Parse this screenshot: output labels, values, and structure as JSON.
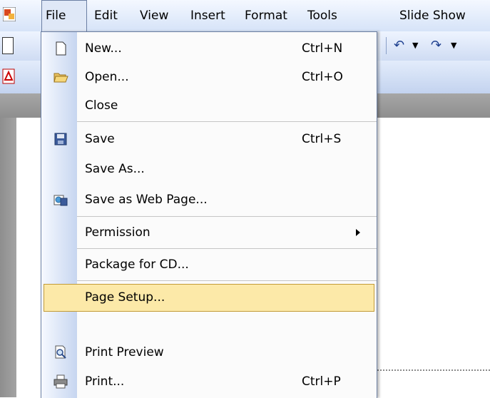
{
  "menubar": {
    "items": [
      {
        "label": "File"
      },
      {
        "label": "Edit"
      },
      {
        "label": "View"
      },
      {
        "label": "Insert"
      },
      {
        "label": "Format"
      },
      {
        "label": "Tools"
      },
      {
        "label": "Slide Show"
      }
    ]
  },
  "file_menu": {
    "items": [
      {
        "label": "New...",
        "shortcut": "Ctrl+N",
        "icon": "new-document-icon"
      },
      {
        "label": "Open...",
        "shortcut": "Ctrl+O",
        "icon": "open-folder-icon"
      },
      {
        "label": "Close",
        "shortcut": "",
        "icon": ""
      },
      {
        "label": "Save",
        "shortcut": "Ctrl+S",
        "icon": "save-disk-icon"
      },
      {
        "label": "Save As...",
        "shortcut": "",
        "icon": ""
      },
      {
        "label": "Save as Web Page...",
        "shortcut": "",
        "icon": "web-page-icon"
      },
      {
        "label": "Permission",
        "shortcut": "",
        "icon": "",
        "submenu": true
      },
      {
        "label": "Package for CD...",
        "shortcut": "",
        "icon": ""
      },
      {
        "label": "Page Setup...",
        "shortcut": "",
        "icon": "",
        "highlighted": true
      },
      {
        "label": "Print Preview",
        "shortcut": "",
        "icon": "print-preview-icon"
      },
      {
        "label": "Print...",
        "shortcut": "Ctrl+P",
        "icon": "printer-icon"
      }
    ]
  },
  "colors": {
    "highlight_fill": "#fce9a8",
    "highlight_border": "#c29b37",
    "gutter_blue": "#c7d6f0",
    "menubar_blue": "#d6e3f8"
  }
}
